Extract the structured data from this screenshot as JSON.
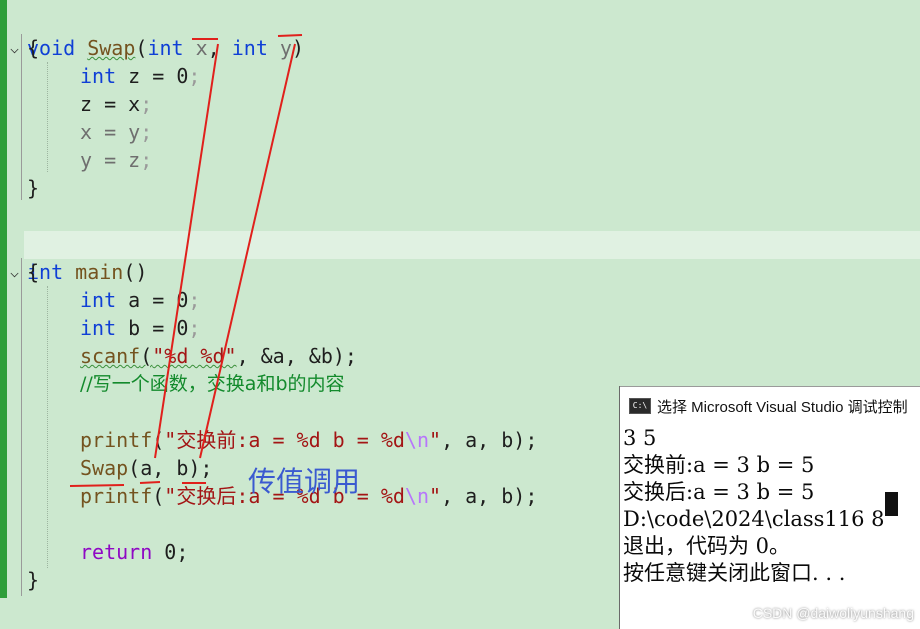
{
  "editor": {
    "swap_func": {
      "kw_void": "void",
      "name": "Swap",
      "open_paren": "(",
      "kw_int1": "int",
      "param_x": " x",
      "comma": ", ",
      "kw_int2": "int",
      "param_y": " y",
      "close_paren": ")",
      "open_brace": "{",
      "decl_kw": "int",
      "decl_rest": " z = 0",
      "line_z": "z = x",
      "line_x": "x = y",
      "line_y": "y = z",
      "semicolon": ";",
      "close_brace": "}"
    },
    "main_func": {
      "kw_int": "int",
      "name": "main",
      "parens": "()",
      "open_brace": "{",
      "decl_a_kw": "int",
      "decl_a_rest": " a = 0",
      "decl_b_kw": "int",
      "decl_b_rest": " b = 0",
      "scanf_name": "scanf",
      "scanf_open": "(",
      "scanf_str": "\"%d %d\"",
      "scanf_args": ", &a, &b);",
      "comment": "//写一个函数，交换a和b的内容",
      "printf1_name": "printf",
      "printf1_open": "(",
      "printf1_str": "\"交换前:a = %d b = %d",
      "printf1_esc": "\\n",
      "printf1_end": "\"",
      "printf1_args": ", a, b);",
      "swap_call_name": "Swap",
      "swap_call_args": "(a, b);",
      "printf2_name": "printf",
      "printf2_open": "(",
      "printf2_str": "\"交换后:a = %d b = %d",
      "printf2_esc": "\\n",
      "printf2_end": "\"",
      "printf2_args": ", a, b);",
      "return_kw": "return",
      "return_rest": " 0;",
      "close_brace": "}"
    },
    "fold_glyph": "⌵"
  },
  "annotation": {
    "handwritten_label": "传值调用",
    "stroke_color": "#e0201c"
  },
  "console": {
    "title": "选择 Microsoft Visual Studio 调试控制",
    "icon_label": "C:\\",
    "lines": [
      "3 5",
      "交换前:a = 3 b = 5",
      "交换后:a = 3 b = 5",
      "",
      "D:\\code\\2024\\class116 8",
      "退出，代码为 0。",
      "按任意键关闭此窗口. . ."
    ]
  },
  "watermark": "CSDN @daiwoliyunshang",
  "colors": {
    "editor_bg": "#cce8cf",
    "keyword": "#0f3fd6",
    "function": "#74531f",
    "string": "#a31515",
    "comment": "#138a2c",
    "return_keyword": "#8f08c4",
    "gutter_bar": "#2e9e3a"
  }
}
